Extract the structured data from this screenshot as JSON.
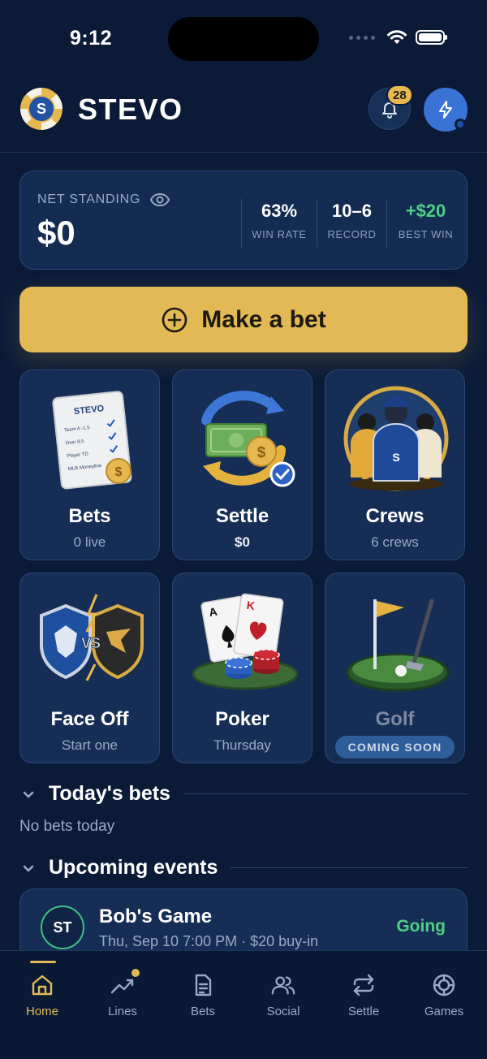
{
  "status_bar": {
    "time": "9:12"
  },
  "header": {
    "brand": "STEVO",
    "logo_letter": "S",
    "notification_count": "28"
  },
  "standing": {
    "label": "NET STANDING",
    "value": "$0",
    "stats": [
      {
        "value": "63%",
        "label": "WIN RATE"
      },
      {
        "value": "10–6",
        "label": "RECORD"
      },
      {
        "value": "+$20",
        "label": "BEST WIN"
      }
    ]
  },
  "make_bet": {
    "label": "Make a bet"
  },
  "tiles": {
    "bets": {
      "title": "Bets",
      "sub": "0 live",
      "card_brand": "STEVO",
      "card_lines": [
        "Team A -1.5",
        "Over 8.5",
        "Player TD",
        "MLB Moneyline"
      ]
    },
    "settle": {
      "title": "Settle",
      "sub": "$0"
    },
    "crews": {
      "title": "Crews",
      "sub": "6 crews"
    },
    "face_off": {
      "title": "Face Off",
      "sub": "Start one",
      "vs": "VS"
    },
    "poker": {
      "title": "Poker",
      "sub": "Thursday"
    },
    "golf": {
      "title": "Golf",
      "badge": "COMING SOON"
    }
  },
  "todays_bets": {
    "title": "Today's bets",
    "empty": "No bets today"
  },
  "upcoming": {
    "title": "Upcoming events",
    "events": [
      {
        "initials": "ST",
        "name": "Bob's Game",
        "meta": "Thu, Sep 10 7:00 PM · $20 buy-in",
        "status": "Going"
      }
    ]
  },
  "nav": {
    "home": "Home",
    "lines": "Lines",
    "bets": "Bets",
    "social": "Social",
    "settle": "Settle",
    "games": "Games"
  },
  "colors": {
    "accent": "#e3b955",
    "background": "#0b1b37",
    "card": "#162e55",
    "positive": "#4fcf86",
    "primary_blue": "#3a73d6"
  }
}
